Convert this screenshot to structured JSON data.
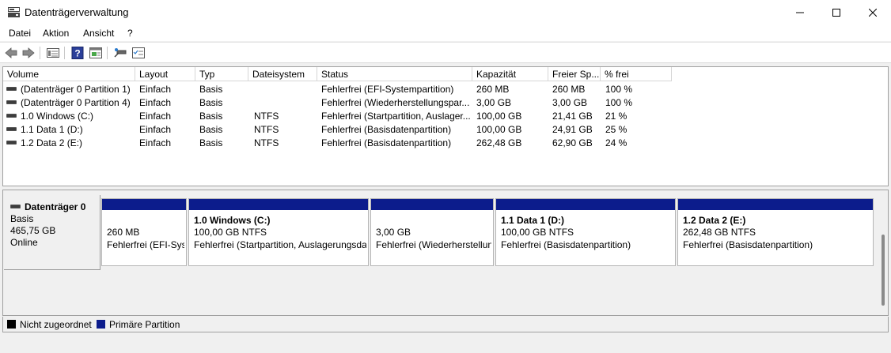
{
  "window": {
    "title": "Datenträgerverwaltung"
  },
  "menu": [
    "Datei",
    "Aktion",
    "Ansicht",
    "?"
  ],
  "columns": [
    "Volume",
    "Layout",
    "Typ",
    "Dateisystem",
    "Status",
    "Kapazität",
    "Freier Sp...",
    "% frei"
  ],
  "volumes": [
    [
      "(Datenträger 0 Partition 1)",
      "Einfach",
      "Basis",
      "",
      "Fehlerfrei (EFI-Systempartition)",
      "260 MB",
      "260 MB",
      "100 %"
    ],
    [
      "(Datenträger 0 Partition 4)",
      "Einfach",
      "Basis",
      "",
      "Fehlerfrei (Wiederherstellungspar...",
      "3,00 GB",
      "3,00 GB",
      "100 %"
    ],
    [
      "1.0 Windows (C:)",
      "Einfach",
      "Basis",
      "NTFS",
      "Fehlerfrei (Startpartition, Auslager...",
      "100,00 GB",
      "21,41 GB",
      "21 %"
    ],
    [
      "1.1 Data 1 (D:)",
      "Einfach",
      "Basis",
      "NTFS",
      "Fehlerfrei (Basisdatenpartition)",
      "100,00 GB",
      "24,91 GB",
      "25 %"
    ],
    [
      "1.2 Data 2 (E:)",
      "Einfach",
      "Basis",
      "NTFS",
      "Fehlerfrei (Basisdatenpartition)",
      "262,48 GB",
      "62,90 GB",
      "24 %"
    ]
  ],
  "disk": {
    "name": "Datenträger 0",
    "type": "Basis",
    "size": "465,75 GB",
    "state": "Online",
    "partitions": [
      {
        "name": "",
        "size": "260 MB",
        "status": "Fehlerfrei (EFI-Systempartition)"
      },
      {
        "name": "1.0 Windows  (C:)",
        "size": "100,00 GB NTFS",
        "status": "Fehlerfrei (Startpartition, Auslagerungsdatei)"
      },
      {
        "name": "",
        "size": "3,00 GB",
        "status": "Fehlerfrei (Wiederherstellungspartition)"
      },
      {
        "name": "1.1 Data 1  (D:)",
        "size": "100,00 GB NTFS",
        "status": "Fehlerfrei (Basisdatenpartition)"
      },
      {
        "name": "1.2 Data 2  (E:)",
        "size": "262,48 GB NTFS",
        "status": "Fehlerfrei (Basisdatenpartition)"
      }
    ]
  },
  "legend": [
    {
      "label": "Nicht zugeordnet",
      "color": "#000000"
    },
    {
      "label": "Primäre Partition",
      "color": "#0c1c8c"
    }
  ],
  "toolbar_icons": [
    "back-icon",
    "forward-icon",
    "view-list-icon",
    "help-icon",
    "view-pane-icon",
    "rescan-icon",
    "properties-icon"
  ]
}
